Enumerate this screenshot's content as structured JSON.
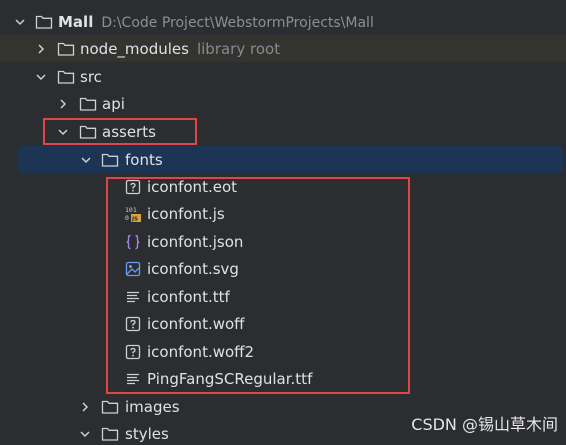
{
  "project": {
    "name": "Mall",
    "path": "D:\\Code Project\\WebstormProjects\\Mall"
  },
  "node_modules": {
    "name": "node_modules",
    "note": "library root"
  },
  "src": {
    "name": "src"
  },
  "api": {
    "name": "api"
  },
  "asserts": {
    "name": "asserts"
  },
  "fonts": {
    "name": "fonts"
  },
  "files": [
    {
      "name": "iconfont.eot",
      "icon": "unknown-file-icon"
    },
    {
      "name": "iconfont.js",
      "icon": "javascript-file-icon"
    },
    {
      "name": "iconfont.json",
      "icon": "json-file-icon"
    },
    {
      "name": "iconfont.svg",
      "icon": "image-file-icon"
    },
    {
      "name": "iconfont.ttf",
      "icon": "text-file-icon"
    },
    {
      "name": "iconfont.woff",
      "icon": "unknown-file-icon"
    },
    {
      "name": "iconfont.woff2",
      "icon": "unknown-file-icon"
    },
    {
      "name": "PingFangSCRegular.ttf",
      "icon": "text-file-icon"
    }
  ],
  "images": {
    "name": "images"
  },
  "styles": {
    "name": "styles"
  },
  "watermark": "CSDN @锡山草木间",
  "colors": {
    "background": "#2b2d30",
    "selection": "#1d3554",
    "highlight_border": "#e0454a",
    "library_row": "#333330"
  }
}
